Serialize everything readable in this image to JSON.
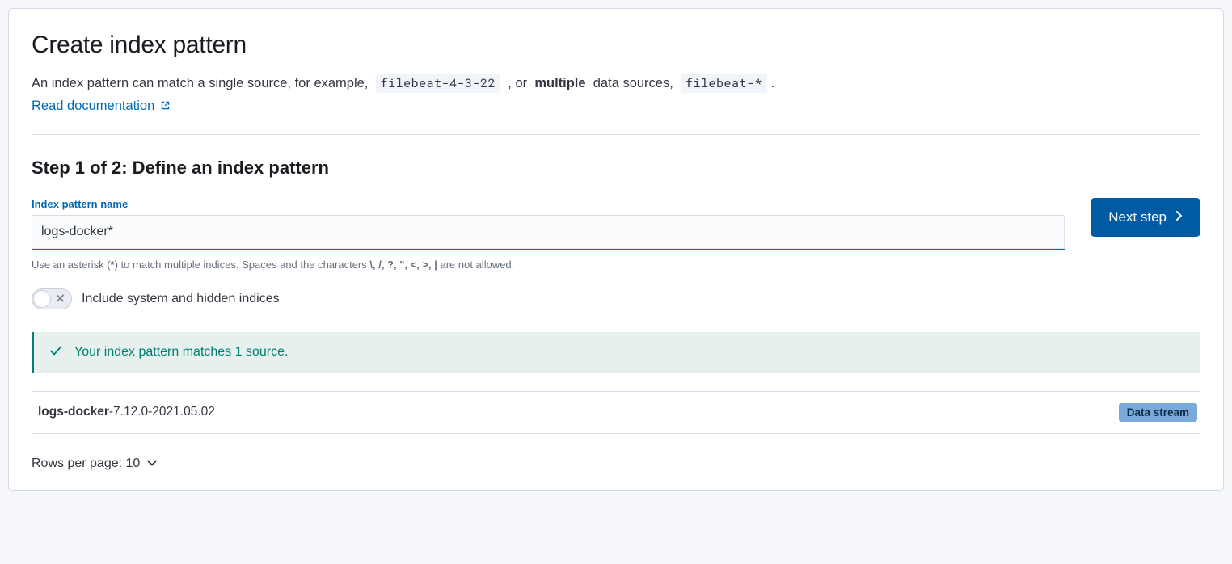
{
  "header": {
    "title": "Create index pattern",
    "intro_seg1": "An index pattern can match a single source, for example, ",
    "intro_code1": "filebeat-4-3-22",
    "intro_seg2": " , or ",
    "intro_bold": "multiple",
    "intro_seg3": " data sources, ",
    "intro_code2": "filebeat-*",
    "intro_seg4": " .",
    "doc_link": "Read documentation"
  },
  "step": {
    "title": "Step 1 of 2: Define an index pattern",
    "label": "Index pattern name",
    "input_value": "logs-docker*",
    "help_prefix": "Use an asterisk (",
    "help_asterisk": "*",
    "help_mid": ") to match multiple indices. Spaces and the characters ",
    "help_chars": "\\, /, ?, \", <, >, |",
    "help_suffix": " are not allowed.",
    "next_button": "Next step",
    "switch_label": "Include system and hidden indices"
  },
  "callout": {
    "text": "Your index pattern matches 1 source."
  },
  "results": [
    {
      "name_bold": "logs-docker",
      "name_rest": "-7.12.0-2021.05.02",
      "badge": "Data stream"
    }
  ],
  "pager": {
    "label": "Rows per page: 10"
  }
}
